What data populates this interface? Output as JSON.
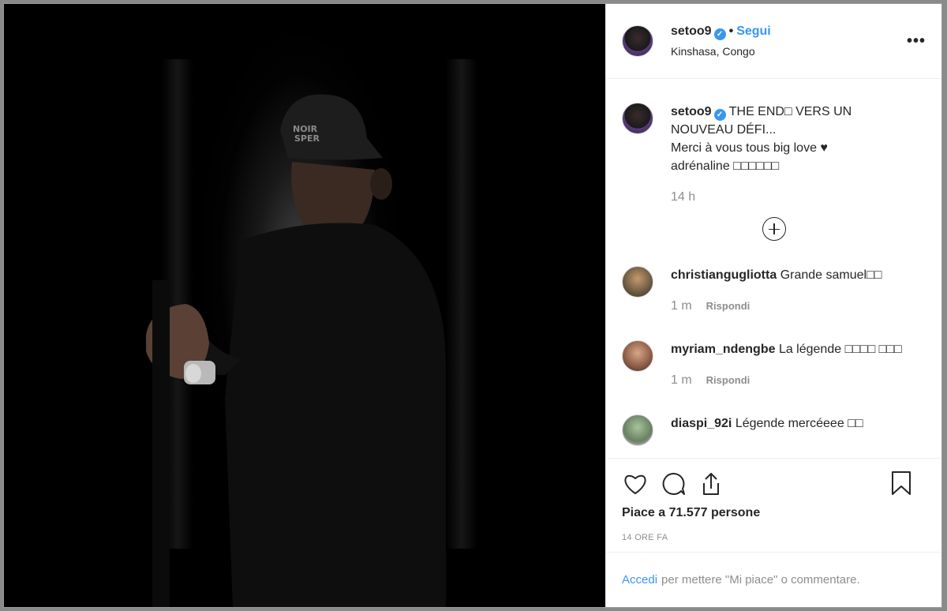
{
  "post": {
    "username": "setoo9",
    "follow_label": "Segui",
    "location": "Kinshasa, Congo",
    "more_label": "•••"
  },
  "caption": {
    "username": "setoo9",
    "line1": "THE END□ VERS UN NOUVEAU DÉFI...",
    "line2": "Merci à vous tous big love ♥",
    "line3": "adrénaline □□□□□□",
    "time": "14 h"
  },
  "comments": [
    {
      "username": "christiangugliotta",
      "text": "Grande samuel□□",
      "time": "1 m",
      "reply": "Rispondi"
    },
    {
      "username": "myriam_ndengbe",
      "text": "La légende □□□□ □□□",
      "time": "1 m",
      "reply": "Rispondi"
    },
    {
      "username": "diaspi_92i",
      "text": "Légende mercéeee □□"
    }
  ],
  "footer": {
    "likes": "Piace a 71.577 persone",
    "ago": "14 ORE FA",
    "login_link": "Accedi",
    "login_rest": "per mettere \"Mi piace\" o commentare."
  },
  "colors": {
    "accent": "#3897f0",
    "muted": "#8e8e8e",
    "text": "#262626"
  },
  "icons": [
    "heart-icon",
    "comment-icon",
    "share-icon",
    "bookmark-icon",
    "plus-circle-icon",
    "verified-badge-icon",
    "more-options-icon"
  ]
}
